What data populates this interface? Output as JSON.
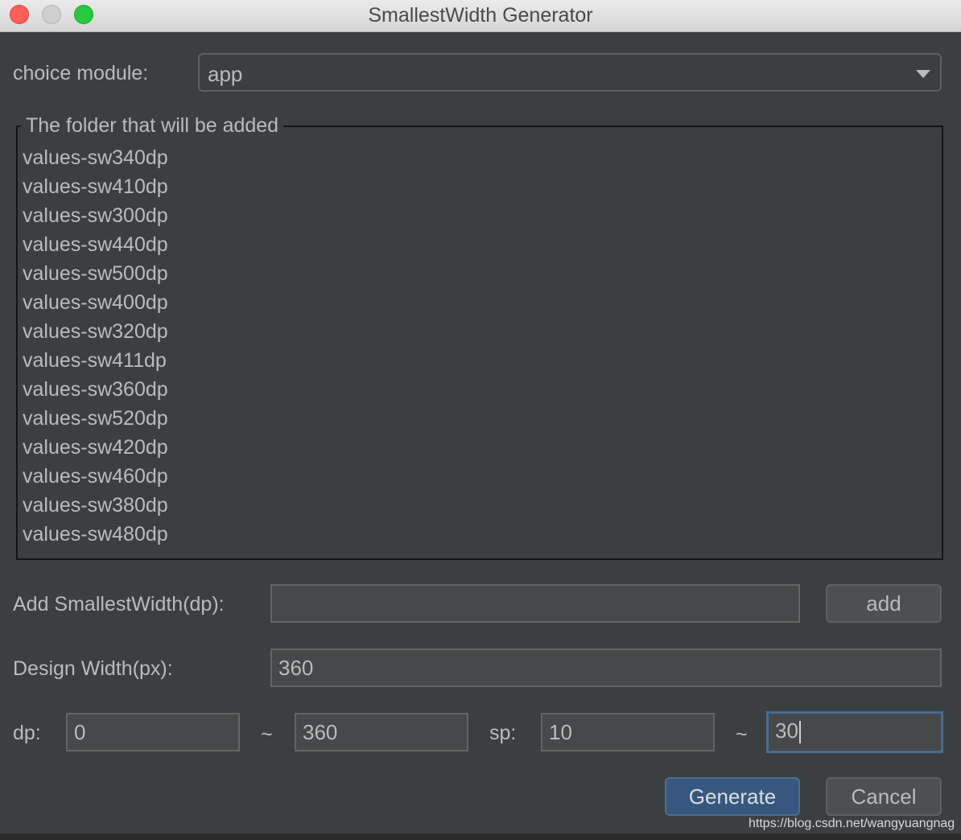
{
  "window": {
    "title": "SmallestWidth Generator"
  },
  "module": {
    "label": "choice module:",
    "selected": "app"
  },
  "folders": {
    "title": "The folder that will be added",
    "items": [
      "values-sw340dp",
      "values-sw410dp",
      "values-sw300dp",
      "values-sw440dp",
      "values-sw500dp",
      "values-sw400dp",
      "values-sw320dp",
      "values-sw411dp",
      "values-sw360dp",
      "values-sw520dp",
      "values-sw420dp",
      "values-sw460dp",
      "values-sw380dp",
      "values-sw480dp"
    ]
  },
  "add_width": {
    "label": "Add SmallestWidth(dp):",
    "value": "",
    "button": "add"
  },
  "design_width": {
    "label": "Design Width(px):",
    "value": "360"
  },
  "dp": {
    "label": "dp:",
    "from": "0",
    "separator": "~",
    "to": "360"
  },
  "sp": {
    "label": "sp:",
    "from": "10",
    "separator": "~",
    "to": "30"
  },
  "actions": {
    "generate": "Generate",
    "cancel": "Cancel"
  },
  "watermark": "https://blog.csdn.net/wangyuangnag"
}
